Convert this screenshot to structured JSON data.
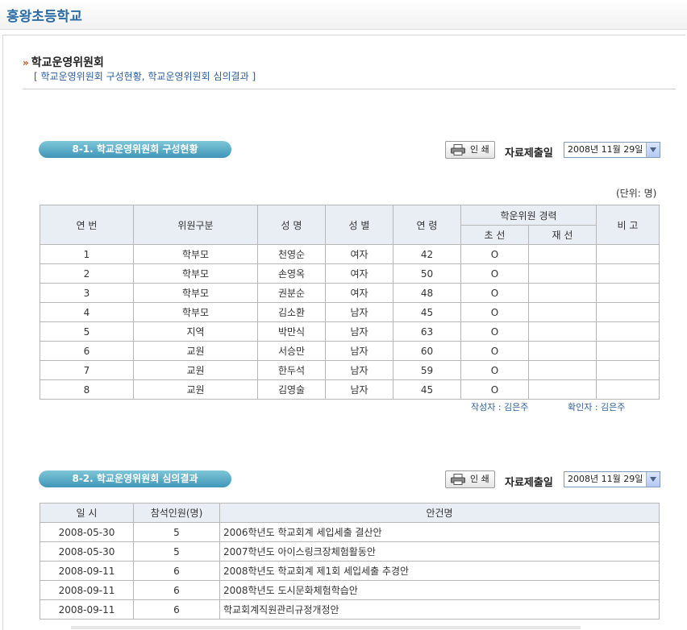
{
  "header": {
    "school_name": "흥왕초등학교"
  },
  "page": {
    "title": "학교운영위원회",
    "subtitle": "[ 학교운영위원회 구성현황, 학교운영위원회 심의결과 ]"
  },
  "section1": {
    "title": "8-1. 학교운영위원회 구성현황",
    "print_label": "인 쇄",
    "date_label": "자료제출일",
    "date_value": "2008년 11월 29일",
    "unit": "(단위: 명)",
    "columns": {
      "no": "연 번",
      "category": "위원구분",
      "name": "성 명",
      "gender": "성 별",
      "age": "연 령",
      "career": "학운위원 경력",
      "first": "초 선",
      "re": "재 선",
      "note": "비 고"
    },
    "rows": [
      {
        "no": "1",
        "category": "학부모",
        "name": "천영순",
        "gender": "여자",
        "age": "42",
        "first": "O",
        "re": "",
        "note": ""
      },
      {
        "no": "2",
        "category": "학부모",
        "name": "손영옥",
        "gender": "여자",
        "age": "50",
        "first": "O",
        "re": "",
        "note": ""
      },
      {
        "no": "3",
        "category": "학부모",
        "name": "권분순",
        "gender": "여자",
        "age": "48",
        "first": "O",
        "re": "",
        "note": ""
      },
      {
        "no": "4",
        "category": "학부모",
        "name": "김소환",
        "gender": "남자",
        "age": "45",
        "first": "O",
        "re": "",
        "note": ""
      },
      {
        "no": "5",
        "category": "지역",
        "name": "박만식",
        "gender": "남자",
        "age": "63",
        "first": "O",
        "re": "",
        "note": ""
      },
      {
        "no": "6",
        "category": "교원",
        "name": "서승만",
        "gender": "남자",
        "age": "60",
        "first": "O",
        "re": "",
        "note": ""
      },
      {
        "no": "7",
        "category": "교원",
        "name": "한두석",
        "gender": "남자",
        "age": "59",
        "first": "O",
        "re": "",
        "note": ""
      },
      {
        "no": "8",
        "category": "교원",
        "name": "김영술",
        "gender": "남자",
        "age": "45",
        "first": "O",
        "re": "",
        "note": ""
      }
    ],
    "author": "작성자 : 김은주",
    "confirmer": "확인자 : 김은주"
  },
  "section2": {
    "title": "8-2. 학교운영위원회 심의결과",
    "print_label": "인 쇄",
    "date_label": "자료제출일",
    "date_value": "2008년 11월 29일",
    "columns": {
      "date": "일 시",
      "attendees": "참석인원(명)",
      "agenda": "안건명"
    },
    "rows": [
      {
        "date": "2008-05-30",
        "attendees": "5",
        "agenda": "2006학년도 학교회계 세입세출 결산안"
      },
      {
        "date": "2008-05-30",
        "attendees": "5",
        "agenda": "2007학년도 아이스링크장체험활동안"
      },
      {
        "date": "2008-09-11",
        "attendees": "6",
        "agenda": "2008학년도 학교회계 제1회 세입세출 추경안"
      },
      {
        "date": "2008-09-11",
        "attendees": "6",
        "agenda": "2008학년도 도시문화체험학습안"
      },
      {
        "date": "2008-09-11",
        "attendees": "6",
        "agenda": "학교회계직원관리규정개정안"
      }
    ]
  }
}
